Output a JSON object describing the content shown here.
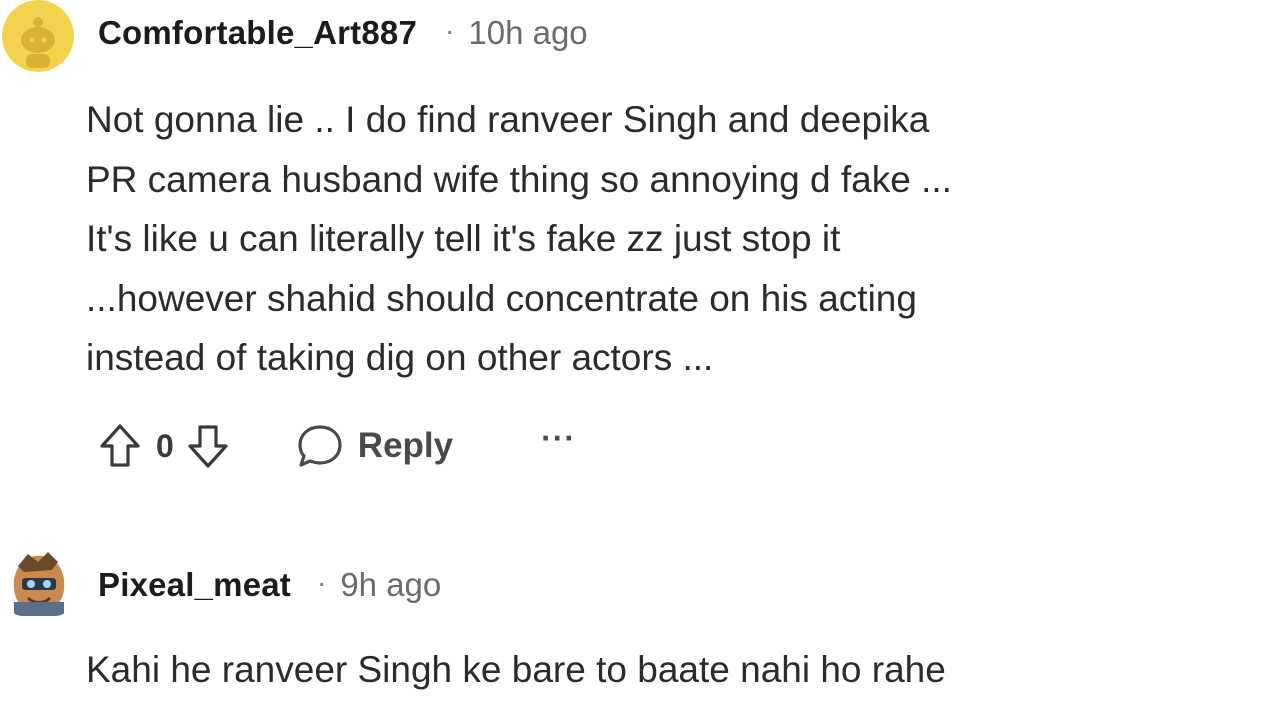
{
  "comments": [
    {
      "username": "Comfortable_Art887",
      "separator": "·",
      "time": "10h ago",
      "body": "Not gonna lie .. I do find ranveer Singh and deepika\nPR camera husband wife thing so annoying d fake ...\nIt's like u can literally tell it's fake zz just stop it\n...however shahid should concentrate on his acting\ninstead of taking dig on other actors ...",
      "vote_count": "0",
      "reply_label": "Reply",
      "more_label": "···",
      "avatar_icon": "snoo-avatar-icon"
    },
    {
      "username": "Pixeal_meat",
      "separator": "·",
      "time": "9h ago",
      "body": "Kahi he ranveer Singh ke bare to baate nahi ho rahe",
      "avatar_icon": "character-avatar-icon"
    }
  ],
  "colors": {
    "background": "#ffffff",
    "username": "#1c1c1c",
    "meta": "#6b6b6b",
    "body": "#2b2b2b",
    "avatar_yellow": "#f2d34b"
  }
}
